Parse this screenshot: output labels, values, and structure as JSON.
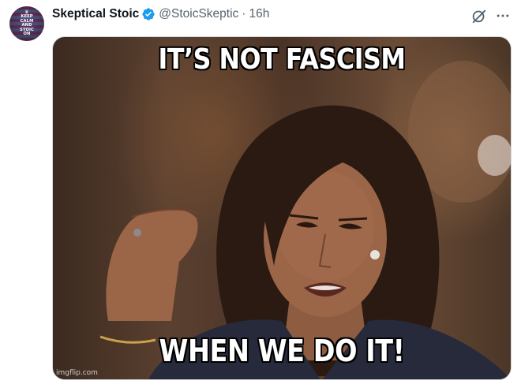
{
  "tweet": {
    "author": {
      "display_name": "Skeptical Stoic",
      "handle": "@StoicSkeptic",
      "verified": true,
      "verified_color": "#1d9bf0",
      "avatar": {
        "icon": "crown-icon",
        "lines": [
          "KEEP",
          "CALM",
          "AND",
          "STOIC",
          "ON"
        ]
      }
    },
    "separator": "·",
    "timestamp": "16h",
    "actions": {
      "grok_icon": "grok-icon",
      "more_icon": "more-options-icon"
    },
    "media": {
      "meme_top_text": "IT’S NOT FASCISM",
      "meme_bottom_text": "WHEN WE DO IT!",
      "watermark": "imgflip.com"
    }
  },
  "colors": {
    "text_primary": "#0f1419",
    "text_secondary": "#536471",
    "border": "#cfd9de"
  }
}
